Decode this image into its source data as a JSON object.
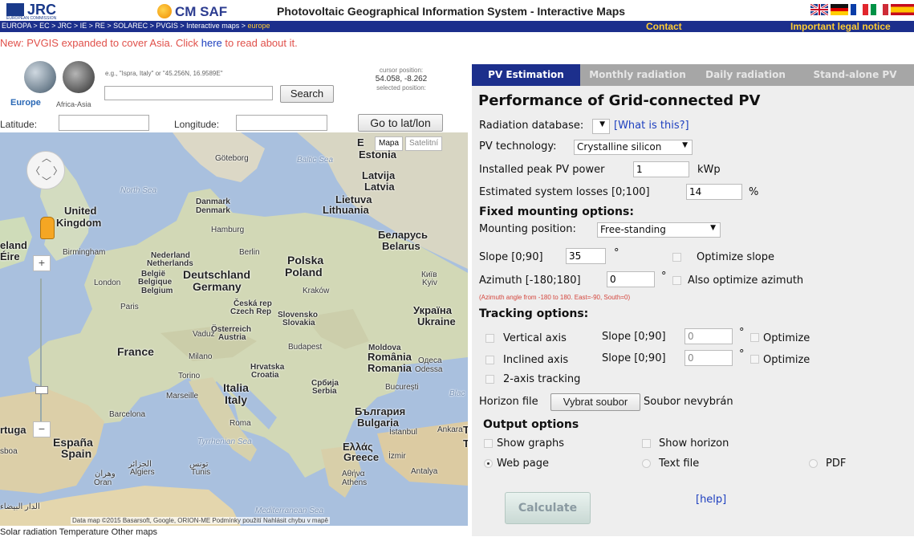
{
  "header": {
    "jrc_logo": "JRC",
    "jrc_sub": "EUROPEAN COMMISSION",
    "cmsaf_logo": "CM SAF",
    "title": "Photovoltaic Geographical Information System - Interactive Maps",
    "flags": [
      "flag-uk",
      "flag-de",
      "flag-fr",
      "flag-it",
      "flag-es"
    ]
  },
  "nav": {
    "breadcrumb": "EUROPA > EC > JRC > IE > RE > SOLAREC > PVGIS > Interactive maps > ",
    "breadcrumb_current": "europe",
    "contact": "Contact",
    "legal": "Important legal notice"
  },
  "announcement": {
    "before": "New: PVGIS expanded to cover Asia. Click ",
    "link": "here",
    "after": " to read about it."
  },
  "search": {
    "region_europe": "Europe",
    "region_africa_asia": "Africa-Asia",
    "hint": "e.g., \"Ispra, Italy\" or \"45.256N, 16.9589E\"",
    "value": "",
    "search_button": "Search",
    "cursor_label": "cursor position:",
    "cursor_value": "54.058, -8.262",
    "selected_label": "selected position:",
    "latitude_label": "Latitude:",
    "longitude_label": "Longitude:",
    "goto_button": "Go to lat/lon"
  },
  "map": {
    "type_map": "Mapa",
    "type_satellite": "Satelitní",
    "attribution": "Data map ©2015 Basarsoft, Google, ORION-ME   Podmínky použití   Nahlásit chybu v mapě",
    "labels": {
      "estonia": "Estonia",
      "latvija": "Latvija",
      "latvia": "Latvia",
      "lietuva": "Lietuva",
      "lithuania": "Lithuania",
      "uk1": "United",
      "uk2": "Kingdom",
      "ireland": "eland",
      "eire": "Éire",
      "danmark": "Danmark",
      "denmark": "Denmark",
      "nederland": "Nederland",
      "netherlands": "Netherlands",
      "belgie": "België",
      "belgique": "Belgique",
      "belgium": "Belgium",
      "deutschland": "Deutschland",
      "germany": "Germany",
      "polska": "Polska",
      "poland": "Poland",
      "belarus_cyr": "Беларусь",
      "belarus": "Belarus",
      "ceska": "Česká rep",
      "czech": "Czech Rep",
      "slovensko": "Slovensko",
      "slovakia": "Slovakia",
      "ukraina": "Україна",
      "ukraine": "Ukraine",
      "osterreich": "Österreich",
      "austria": "Austria",
      "moldova": "Moldova",
      "france": "France",
      "hrvatska": "Hrvatska",
      "croatia": "Croatia",
      "romania1": "România",
      "romania2": "Romania",
      "italia": "Italia",
      "italy": "Italy",
      "srbija": "Србија",
      "serbia": "Serbia",
      "balgaria": "България",
      "bulgaria": "Bulgaria",
      "espana": "España",
      "spain": "Spain",
      "ellas": "Ελλάς",
      "greece": "Greece",
      "portugal": "rtuga",
      "goteborg": "Göteborg",
      "hamburg": "Hamburg",
      "birmingham": "Birmingham",
      "berlin": "Berlin",
      "london": "London",
      "paris": "Paris",
      "krakow": "Kraków",
      "kyiv_cyr": "Київ",
      "kyiv": "Kyiv",
      "vaduz": "Vaduz",
      "budapest": "Budapest",
      "milano": "Milano",
      "torino": "Torino",
      "marseille": "Marseille",
      "odesa_cyr": "Одеса",
      "odessa": "Odessa",
      "bucuresti": "București",
      "barcelona": "Barcelona",
      "roma": "Roma",
      "istanbul": "İstanbul",
      "ankara": "Ankara",
      "izmir": "İzmir",
      "antalya": "Antalya",
      "athina": "Αθήνα",
      "athens": "Athens",
      "algiers_ar": "الجزائر",
      "algiers": "Algiers",
      "tunis_ar": "تونس",
      "tunis": "Tunis",
      "oran_ar": "وهران",
      "oran": "Oran",
      "casablanca_ar": "الدار البيضاء",
      "lisboa": "sboa",
      "baltic": "Baltic Sea",
      "north_sea": "North Sea",
      "tyrrhenian": "Tyrrhenian Sea",
      "mediterranean": "Mediterranean Sea",
      "black": "Blac",
      "edge_e": "E",
      "edge_t1": "T",
      "edge_t2": "T"
    }
  },
  "bottom_tabs": "Solar radiation    Temperature      Other maps",
  "panel": {
    "tabs": [
      "PV Estimation",
      "Monthly radiation",
      "Daily radiation",
      "Stand-alone PV"
    ],
    "title": "Performance of Grid-connected PV",
    "radiation_db_label": "Radiation database:",
    "radiation_db_value": "",
    "what_is_this": "[What is this?]",
    "pv_tech_label": "PV technology:",
    "pv_tech_value": "Crystalline silicon",
    "peak_power_label": "Installed peak PV power",
    "peak_power_value": "1",
    "peak_power_unit": "kWp",
    "losses_label": "Estimated system losses [0;100]",
    "losses_value": "14",
    "losses_unit": "%",
    "fixed_title": "Fixed mounting options:",
    "mounting_label": "Mounting position:",
    "mounting_value": "Free-standing",
    "slope_label": "Slope [0;90]",
    "slope_value": "35",
    "deg": "°",
    "optimize_slope": "Optimize slope",
    "azimuth_label": "Azimuth [-180;180]",
    "azimuth_value": "0",
    "optimize_azimuth": "Also optimize azimuth",
    "azimuth_note": "(Azimuth angle from -180 to 180. East=-90, South=0)",
    "tracking_title": "Tracking options:",
    "vertical_axis": "Vertical axis",
    "inclined_axis": "Inclined axis",
    "tracking_slope_label": "Slope [0;90]",
    "vertical_slope_value": "0",
    "inclined_slope_value": "0",
    "optimize": "Optimize",
    "two_axis": "2-axis tracking",
    "horizon_label": "Horizon file",
    "horizon_button": "Vybrat soubor",
    "horizon_status": "Soubor nevybrán",
    "output_title": "Output options",
    "show_graphs": "Show graphs",
    "show_horizon": "Show horizon",
    "web_page": "Web page",
    "text_file": "Text file",
    "pdf": "PDF",
    "calculate": "Calculate",
    "help": "[help]"
  }
}
